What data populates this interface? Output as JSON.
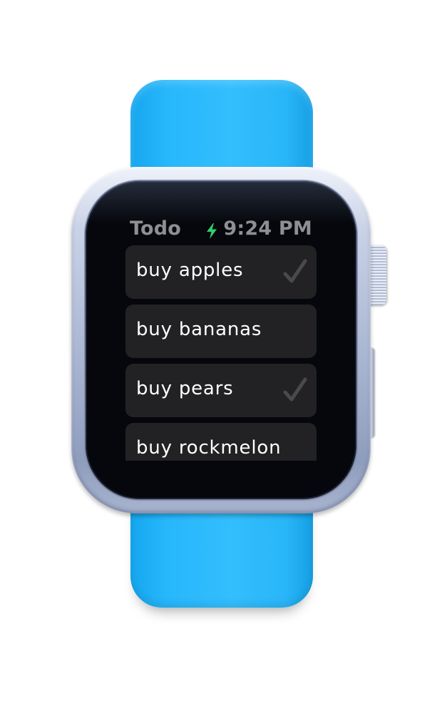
{
  "device": {
    "band_color": "#2ab8fb",
    "case_color": "#b3bfd9",
    "screen_background": "#000000"
  },
  "status_bar": {
    "title": "Todo",
    "charging_icon": "lightning-bolt-icon",
    "charging_color": "#2fd26a",
    "time": "9:24 PM"
  },
  "todo": {
    "items": [
      {
        "label": "buy apples",
        "completed": true
      },
      {
        "label": "buy bananas",
        "completed": false
      },
      {
        "label": "buy pears",
        "completed": true
      },
      {
        "label": "buy rockmelon",
        "completed": false
      }
    ],
    "row_color": "#222224",
    "check_icon": "checkmark-icon",
    "check_color": "#4a4a4d"
  }
}
